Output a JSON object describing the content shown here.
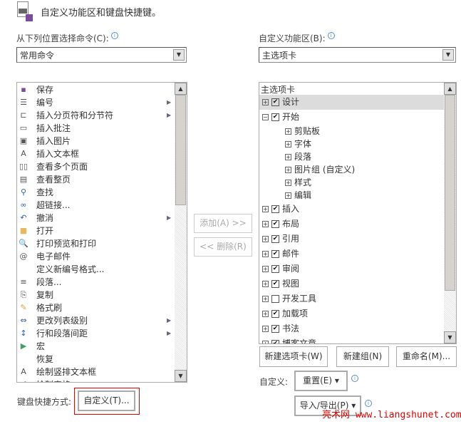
{
  "header": {
    "title": "自定义功能区和键盘快捷键。",
    "icon": "customize-ribbon-icon"
  },
  "left": {
    "label": "从下列位置选择命令(C):",
    "dropdown_value": "常用命令",
    "items": [
      {
        "label": "保存",
        "icon": "save-icon",
        "glyph": "▪",
        "color": "#7b4a9a"
      },
      {
        "label": "编号",
        "icon": "numbering-icon",
        "glyph": "☰",
        "sub": true
      },
      {
        "label": "插入分页符和分节符",
        "icon": "page-break-icon",
        "glyph": "⊏",
        "sub": true
      },
      {
        "label": "插入批注",
        "icon": "comment-icon",
        "glyph": "▭"
      },
      {
        "label": "插入图片",
        "icon": "picture-icon",
        "glyph": "▣"
      },
      {
        "label": "插入文本框",
        "icon": "textbox-icon",
        "glyph": "A"
      },
      {
        "label": "查看多个页面",
        "icon": "multi-page-icon",
        "glyph": "▯▯"
      },
      {
        "label": "查看整页",
        "icon": "one-page-icon",
        "glyph": "▤"
      },
      {
        "label": "查找",
        "icon": "find-icon",
        "glyph": "⚲",
        "color": "#2a5fa8"
      },
      {
        "label": "超链接...",
        "icon": "hyperlink-icon",
        "glyph": "∞",
        "color": "#2a5fa8"
      },
      {
        "label": "撤消",
        "icon": "undo-icon",
        "glyph": "↶",
        "color": "#2a5fa8",
        "sub": true
      },
      {
        "label": "打开",
        "icon": "open-folder-icon",
        "glyph": "■",
        "color": "#e8b860"
      },
      {
        "label": "打印预览和打印",
        "icon": "print-preview-icon",
        "glyph": "🔍"
      },
      {
        "label": "电子邮件",
        "icon": "email-attach-icon",
        "glyph": "@"
      },
      {
        "label": "定义新编号格式...",
        "icon": "",
        "glyph": ""
      },
      {
        "label": "段落...",
        "icon": "paragraph-icon",
        "glyph": "≡"
      },
      {
        "label": "复制",
        "icon": "copy-icon",
        "glyph": "⎘"
      },
      {
        "label": "格式刷",
        "icon": "format-painter-icon",
        "glyph": "✎",
        "color": "#d9a040"
      },
      {
        "label": "更改列表级别",
        "icon": "list-level-icon",
        "glyph": "⇔",
        "color": "#2a5fa8",
        "sub": true
      },
      {
        "label": "行和段落间距",
        "icon": "line-spacing-icon",
        "glyph": "↕",
        "color": "#2a5fa8",
        "sub": true
      },
      {
        "label": "宏",
        "icon": "macro-icon",
        "glyph": "▶",
        "color": "#4a9a6a"
      },
      {
        "label": "恢复",
        "icon": "",
        "glyph": ""
      },
      {
        "label": "绘制竖排文本框",
        "icon": "vertical-textbox-icon",
        "glyph": "A"
      },
      {
        "label": "绘制表格",
        "icon": "draw-table-icon",
        "glyph": "✐"
      }
    ]
  },
  "right": {
    "label": "自定义功能区(B):",
    "dropdown_value": "主选项卡",
    "list_header": "主选项卡",
    "items": [
      {
        "label": "设计",
        "level": 0,
        "expanded": false,
        "checked": true,
        "selected": true
      },
      {
        "label": "开始",
        "level": 0,
        "expanded": true,
        "checked": true
      },
      {
        "label": "剪贴板",
        "level": 1
      },
      {
        "label": "字体",
        "level": 1
      },
      {
        "label": "段落",
        "level": 1
      },
      {
        "label": "图片组 (自定义)",
        "level": 1
      },
      {
        "label": "样式",
        "level": 1
      },
      {
        "label": "编辑",
        "level": 1
      },
      {
        "label": "插入",
        "level": 0,
        "checked": true
      },
      {
        "label": "布局",
        "level": 0,
        "checked": true
      },
      {
        "label": "引用",
        "level": 0,
        "checked": true
      },
      {
        "label": "邮件",
        "level": 0,
        "checked": true
      },
      {
        "label": "审阅",
        "level": 0,
        "checked": true
      },
      {
        "label": "视图",
        "level": 0,
        "checked": true
      },
      {
        "label": "开发工具",
        "level": 0,
        "checked": false
      },
      {
        "label": "加载项",
        "level": 0,
        "checked": true
      },
      {
        "label": "书法",
        "level": 0,
        "checked": true
      },
      {
        "label": "博客文章",
        "level": 0,
        "checked": true
      }
    ]
  },
  "buttons": {
    "add": "添加(A) >>",
    "remove": "<< 删除(R)",
    "new_tab": "新建选项卡(W)",
    "new_group": "新建组(N)",
    "rename": "重命名(M)...",
    "reset": "重置(E) ▾",
    "import_export": "导入/导出(P) ▾",
    "keyboard_customize": "自定义(T)..."
  },
  "labels": {
    "customize": "自定义:",
    "keyboard": "键盘快捷方式:"
  },
  "watermark": "亮术网 www.liangshunet.com",
  "colors": {
    "highlight": "#e60000",
    "selected_row": "#dcdcdc"
  }
}
